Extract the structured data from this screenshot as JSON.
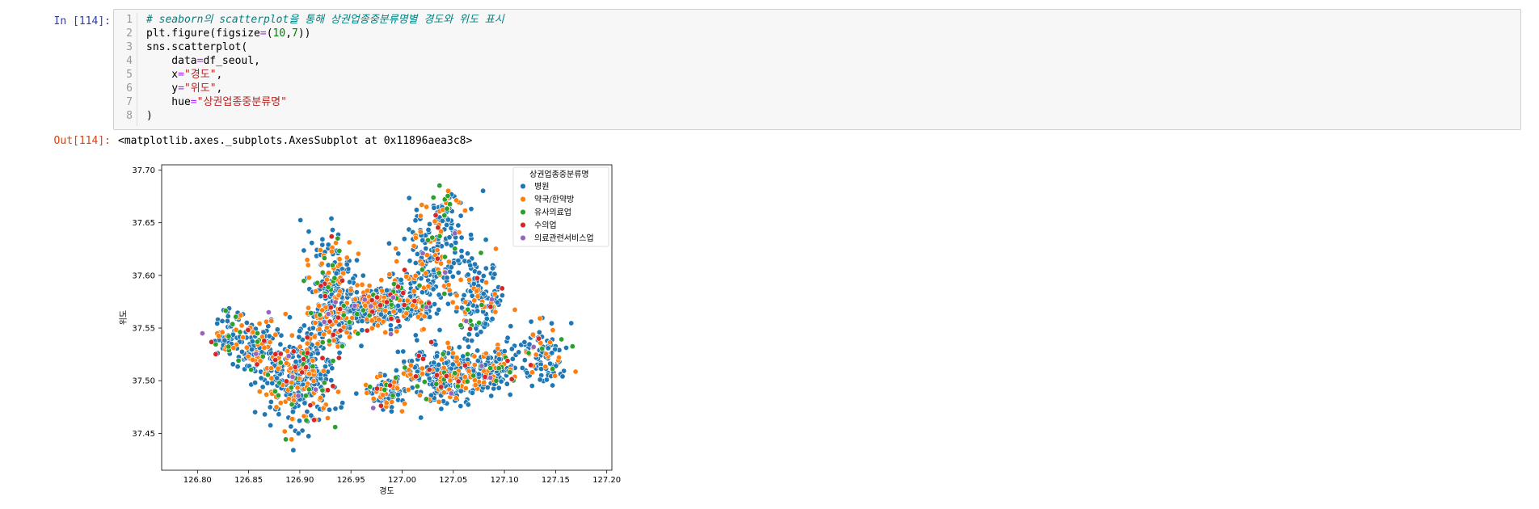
{
  "cell": {
    "in_prompt": "In [114]:",
    "out_prompt": "Out[114]:",
    "line_numbers": [
      "1",
      "2",
      "3",
      "4",
      "5",
      "6",
      "7",
      "8"
    ],
    "output_text": "<matplotlib.axes._subplots.AxesSubplot at 0x11896aea3c8>"
  },
  "code_lines": [
    [
      {
        "t": "# seaborn의 scatterplot을 통해 상권업종중분류명별 경도와 위도 표시",
        "c": "cm"
      }
    ],
    [
      {
        "t": "plt.figure(figsize",
        "c": ""
      },
      {
        "t": "=",
        "c": "op"
      },
      {
        "t": "(",
        "c": ""
      },
      {
        "t": "10",
        "c": "num"
      },
      {
        "t": ",",
        "c": ""
      },
      {
        "t": "7",
        "c": "num"
      },
      {
        "t": "))",
        "c": ""
      }
    ],
    [
      {
        "t": "sns.scatterplot(",
        "c": ""
      }
    ],
    [
      {
        "t": "    data",
        "c": ""
      },
      {
        "t": "=",
        "c": "op"
      },
      {
        "t": "df_seoul,",
        "c": ""
      }
    ],
    [
      {
        "t": "    x",
        "c": ""
      },
      {
        "t": "=",
        "c": "op"
      },
      {
        "t": "\"경도\"",
        "c": "str"
      },
      {
        "t": ",",
        "c": ""
      }
    ],
    [
      {
        "t": "    y",
        "c": ""
      },
      {
        "t": "=",
        "c": "op"
      },
      {
        "t": "\"위도\"",
        "c": "str"
      },
      {
        "t": ",",
        "c": ""
      }
    ],
    [
      {
        "t": "    hue",
        "c": ""
      },
      {
        "t": "=",
        "c": "op"
      },
      {
        "t": "\"상권업종중분류명\"",
        "c": "str"
      }
    ],
    [
      {
        "t": ")",
        "c": ""
      }
    ]
  ],
  "chart_data": {
    "type": "scatter",
    "xlabel": "경도",
    "ylabel": "위도",
    "xlim": [
      126.765,
      127.205
    ],
    "ylim": [
      37.415,
      37.705
    ],
    "xticks": [
      "126.80",
      "126.85",
      "126.90",
      "126.95",
      "127.00",
      "127.05",
      "127.10",
      "127.15",
      "127.20"
    ],
    "xtick_values": [
      126.8,
      126.85,
      126.9,
      126.95,
      127.0,
      127.05,
      127.1,
      127.15,
      127.2
    ],
    "yticks": [
      "37.45",
      "37.50",
      "37.55",
      "37.60",
      "37.65",
      "37.70"
    ],
    "ytick_values": [
      37.45,
      37.5,
      37.55,
      37.6,
      37.65,
      37.7
    ],
    "grid": false,
    "legend_placement": "top-right",
    "legend_title": "상권업종중분류명",
    "series": [
      {
        "name": "병원",
        "color": "#1f77b4",
        "weight": 0.72
      },
      {
        "name": "약국/한약방",
        "color": "#ff7f0e",
        "weight": 0.18
      },
      {
        "name": "유사의료업",
        "color": "#2ca02c",
        "weight": 0.06
      },
      {
        "name": "수의업",
        "color": "#d62728",
        "weight": 0.03
      },
      {
        "name": "의료관련서비스업",
        "color": "#9467bd",
        "weight": 0.01
      }
    ],
    "point_count": 2200,
    "density_regions": [
      {
        "cx": 126.9,
        "cy": 37.5,
        "rx": 0.03,
        "ry": 0.035,
        "w": 18
      },
      {
        "cx": 126.86,
        "cy": 37.53,
        "rx": 0.02,
        "ry": 0.025,
        "w": 7
      },
      {
        "cx": 126.83,
        "cy": 37.545,
        "rx": 0.015,
        "ry": 0.02,
        "w": 4
      },
      {
        "cx": 126.93,
        "cy": 37.55,
        "rx": 0.025,
        "ry": 0.02,
        "w": 8
      },
      {
        "cx": 126.93,
        "cy": 37.6,
        "rx": 0.018,
        "ry": 0.035,
        "w": 8
      },
      {
        "cx": 126.965,
        "cy": 37.57,
        "rx": 0.025,
        "ry": 0.015,
        "w": 9
      },
      {
        "cx": 127.0,
        "cy": 37.575,
        "rx": 0.03,
        "ry": 0.02,
        "w": 12
      },
      {
        "cx": 127.03,
        "cy": 37.62,
        "rx": 0.025,
        "ry": 0.035,
        "w": 10
      },
      {
        "cx": 127.045,
        "cy": 37.665,
        "rx": 0.015,
        "ry": 0.02,
        "w": 4
      },
      {
        "cx": 127.075,
        "cy": 37.58,
        "rx": 0.02,
        "ry": 0.03,
        "w": 7
      },
      {
        "cx": 127.04,
        "cy": 37.505,
        "rx": 0.035,
        "ry": 0.02,
        "w": 16
      },
      {
        "cx": 127.09,
        "cy": 37.51,
        "rx": 0.02,
        "ry": 0.015,
        "w": 6
      },
      {
        "cx": 127.135,
        "cy": 37.525,
        "rx": 0.02,
        "ry": 0.025,
        "w": 6
      },
      {
        "cx": 126.985,
        "cy": 37.49,
        "rx": 0.015,
        "ry": 0.015,
        "w": 5
      }
    ]
  }
}
